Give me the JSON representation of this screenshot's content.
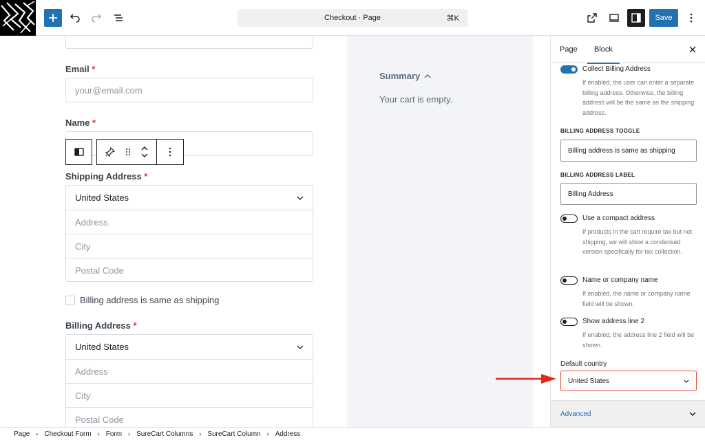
{
  "toolbar": {
    "command_title": "Checkout · Page",
    "shortcut": "⌘K",
    "save_label": "Save"
  },
  "form": {
    "email_label": "Email",
    "required_mark": "*",
    "email_placeholder": "your@email.com",
    "name_label": "Name",
    "shipping_label": "Shipping Address",
    "shipping_country": "United States",
    "address_placeholder": "Address",
    "city_placeholder": "City",
    "postal_placeholder": "Postal Code",
    "billing_same_label": "Billing address is same as shipping",
    "billing_label": "Billing Address",
    "billing_country": "United States"
  },
  "summary": {
    "title": "Summary",
    "empty_text": "Your cart is empty."
  },
  "sidebar": {
    "tabs": [
      "Page",
      "Block"
    ],
    "collect_billing": {
      "title": "Collect Billing Address",
      "help": "If enabled, the user can enter a separate billing address. Otherwise, the billing address will be the same as the shipping address.",
      "enabled": true
    },
    "billing_toggle_caption": "BILLING ADDRESS TOGGLE",
    "billing_toggle_value": "Billing address is same as shipping",
    "billing_label_caption": "BILLING ADDRESS LABEL",
    "billing_label_value": "Billing Address",
    "compact": {
      "title": "Use a compact address",
      "help": "If products in the cart require tax but not shipping, we will show a condensed version specifically for tax collection.",
      "enabled": false
    },
    "company": {
      "title": "Name or company name",
      "help": "If enabled, the name or company name field will be shown.",
      "enabled": false
    },
    "line2": {
      "title": "Show address line 2",
      "help": "If enabled, the address line 2 field will be shown.",
      "enabled": false
    },
    "default_country_label": "Default country",
    "default_country_value": "United States",
    "advanced_label": "Advanced"
  },
  "breadcrumb": [
    "Page",
    "Checkout Form",
    "Form",
    "SureCart Columns",
    "SureCart Column",
    "Address"
  ],
  "colors": {
    "accent": "#2271b1",
    "highlight": "#e2513a"
  }
}
